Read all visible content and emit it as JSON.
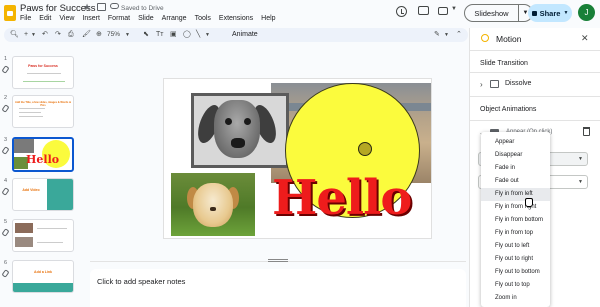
{
  "header": {
    "title": "Paws for Success",
    "saved_status": "Saved to Drive",
    "menu": [
      "File",
      "Edit",
      "View",
      "Insert",
      "Format",
      "Slide",
      "Arrange",
      "Tools",
      "Extensions",
      "Help"
    ],
    "slideshow_label": "Slideshow",
    "share_label": "Share",
    "avatar_initial": "J"
  },
  "toolbar": {
    "zoom": "75%",
    "animate_label": "Animate"
  },
  "filmstrip": {
    "slides": [
      {
        "number": "1",
        "title": "Paws for Success",
        "selected": false
      },
      {
        "number": "2",
        "title": "Add the Title, a few slides, images & Words & Pics",
        "selected": false
      },
      {
        "number": "3",
        "title": "Hello",
        "selected": true
      },
      {
        "number": "4",
        "title": "Add Video",
        "selected": false
      },
      {
        "number": "5",
        "title": "",
        "selected": false
      },
      {
        "number": "6",
        "title": "Add a Link",
        "selected": false
      }
    ]
  },
  "slide": {
    "hello_text": "Hello"
  },
  "notes": {
    "placeholder": "Click to add speaker notes"
  },
  "panel": {
    "title": "Motion",
    "slide_transition_heading": "Slide Transition",
    "transition_value": "Dissolve",
    "object_animations_heading": "Object Animations",
    "animation_row_label": "Appear  (On click)"
  },
  "dropdown": {
    "options": [
      "Appear",
      "Disappear",
      "Fade in",
      "Fade out",
      "Fly in from left",
      "Fly in from right",
      "Fly in from bottom",
      "Fly in from top",
      "Fly out to left",
      "Fly out to right",
      "Fly out to bottom",
      "Fly out to top",
      "Zoom in"
    ],
    "hovered_index": 4
  },
  "colors": {
    "accent": "#0b57d0",
    "share_bg": "#c2e7ff",
    "avatar_bg": "#188038",
    "hello_red": "#ee1c1c",
    "smiley_yellow": "#fbfb3d"
  }
}
